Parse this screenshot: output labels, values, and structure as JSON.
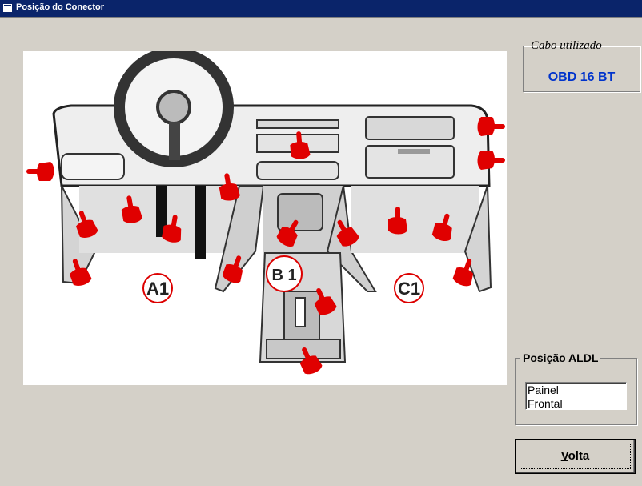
{
  "window": {
    "title": "Posição do Conector"
  },
  "cabo": {
    "legend": "Cabo utilizado",
    "value": "OBD 16 BT"
  },
  "diagram": {
    "zones": [
      {
        "label": "A1"
      },
      {
        "label": "B 1"
      },
      {
        "label": "C1"
      }
    ],
    "pointer_color": "#e00000"
  },
  "aldl": {
    "legend": "Posição ALDL",
    "items": [
      "Painel",
      "Frontal"
    ]
  },
  "back_button": {
    "accel": "V",
    "rest": "olta"
  }
}
